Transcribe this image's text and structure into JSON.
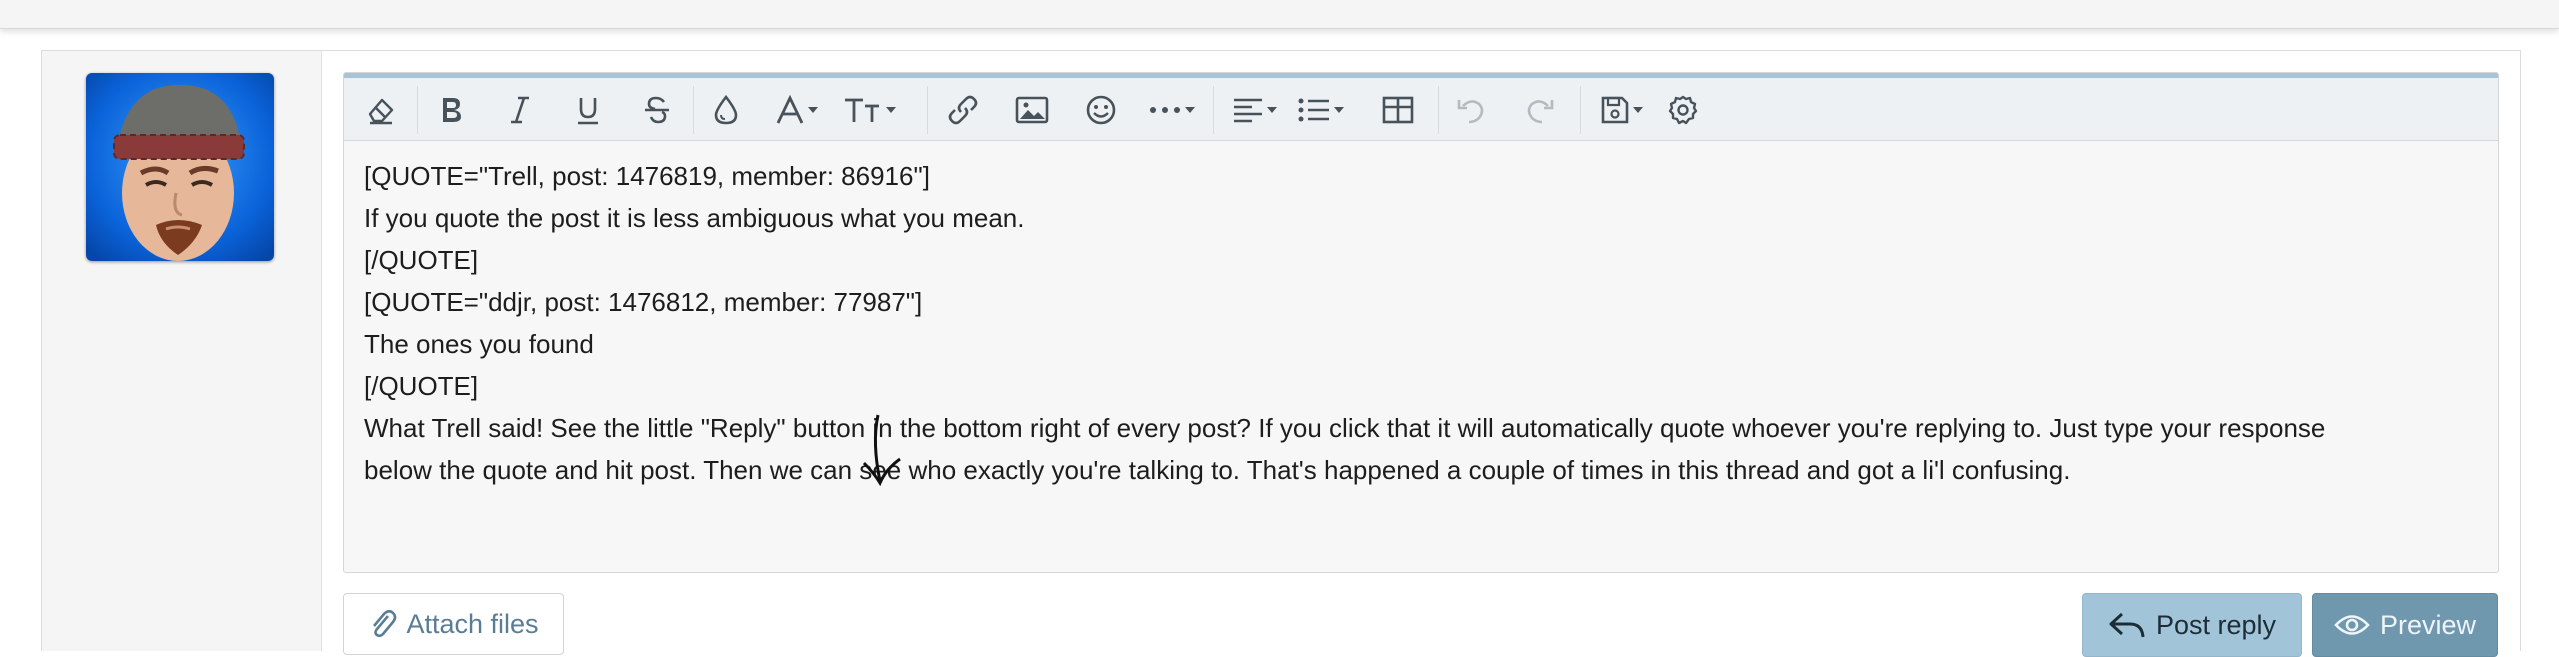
{
  "toolbar": {
    "buttons": [
      {
        "id": "remove-formatting",
        "icon": "eraser-icon"
      },
      {
        "id": "bold",
        "icon": "bold-icon",
        "glyph": "B"
      },
      {
        "id": "italic",
        "icon": "italic-icon",
        "glyph": "I"
      },
      {
        "id": "underline",
        "icon": "underline-icon",
        "glyph": "U"
      },
      {
        "id": "strikethrough",
        "icon": "strikethrough-icon",
        "glyph": "S"
      },
      {
        "id": "text-color",
        "icon": "droplet-icon"
      },
      {
        "id": "font-family",
        "icon": "font-icon",
        "glyph": "A"
      },
      {
        "id": "font-size",
        "icon": "text-size-icon",
        "glyph": "TT"
      },
      {
        "id": "link",
        "icon": "link-icon"
      },
      {
        "id": "image",
        "icon": "image-icon"
      },
      {
        "id": "smilies",
        "icon": "smiley-icon"
      },
      {
        "id": "more",
        "icon": "ellipsis-icon",
        "glyph": "···"
      },
      {
        "id": "align",
        "icon": "align-left-icon"
      },
      {
        "id": "list",
        "icon": "list-icon"
      },
      {
        "id": "table",
        "icon": "table-icon"
      },
      {
        "id": "undo",
        "icon": "undo-icon",
        "disabled": true
      },
      {
        "id": "redo",
        "icon": "redo-icon",
        "disabled": true
      },
      {
        "id": "drafts",
        "icon": "save-icon"
      },
      {
        "id": "settings",
        "icon": "gear-icon"
      }
    ]
  },
  "editor": {
    "lines": [
      "[QUOTE=\"Trell, post: 1476819, member: 86916\"]",
      "If you quote the post it is less ambiguous what you mean.",
      "[/QUOTE]",
      "[QUOTE=\"ddjr, post: 1476812, member: 77987\"]",
      "The ones you found",
      "[/QUOTE]",
      "What Trell said! See the little \"Reply\" button in the bottom right of every post? If you click that it will automatically quote whoever you're replying to. Just type your response",
      "below the quote and hit post. Then we can see who exactly you're talking to. That's happened a couple of times in this thread and got a li'l confusing."
    ]
  },
  "actions": {
    "attach_label": "Attach files",
    "post_reply_label": "Post reply",
    "preview_label": "Preview"
  },
  "colors": {
    "toolbar_accent": "#a8c3d5",
    "post_reply_bg": "#a2c4d8",
    "preview_bg": "#6f98ae",
    "link_text": "#5a7d96"
  }
}
